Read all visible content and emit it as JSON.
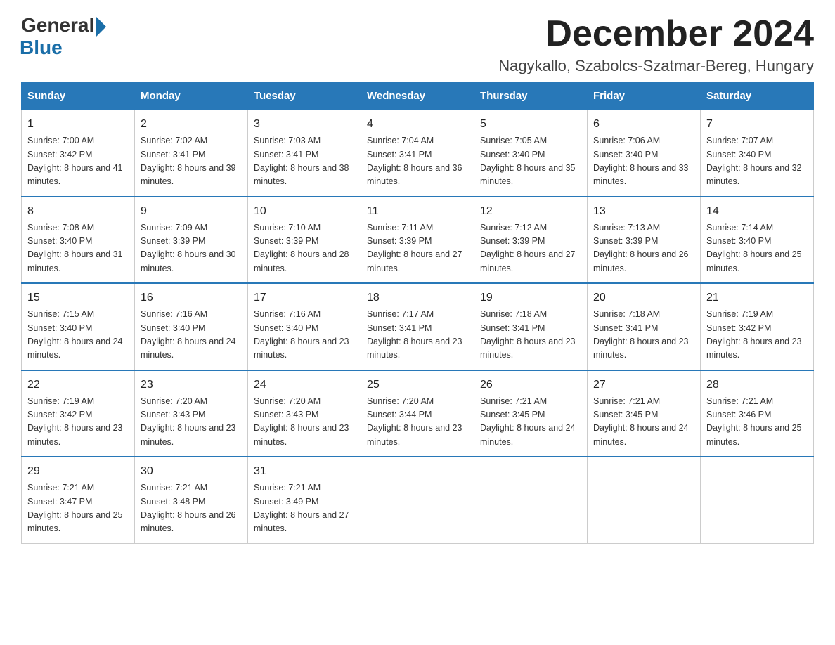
{
  "logo": {
    "general": "General",
    "blue": "Blue"
  },
  "header": {
    "month": "December 2024",
    "location": "Nagykallo, Szabolcs-Szatmar-Bereg, Hungary"
  },
  "days_of_week": [
    "Sunday",
    "Monday",
    "Tuesday",
    "Wednesday",
    "Thursday",
    "Friday",
    "Saturday"
  ],
  "weeks": [
    [
      {
        "day": "1",
        "sunrise": "7:00 AM",
        "sunset": "3:42 PM",
        "daylight": "8 hours and 41 minutes."
      },
      {
        "day": "2",
        "sunrise": "7:02 AM",
        "sunset": "3:41 PM",
        "daylight": "8 hours and 39 minutes."
      },
      {
        "day": "3",
        "sunrise": "7:03 AM",
        "sunset": "3:41 PM",
        "daylight": "8 hours and 38 minutes."
      },
      {
        "day": "4",
        "sunrise": "7:04 AM",
        "sunset": "3:41 PM",
        "daylight": "8 hours and 36 minutes."
      },
      {
        "day": "5",
        "sunrise": "7:05 AM",
        "sunset": "3:40 PM",
        "daylight": "8 hours and 35 minutes."
      },
      {
        "day": "6",
        "sunrise": "7:06 AM",
        "sunset": "3:40 PM",
        "daylight": "8 hours and 33 minutes."
      },
      {
        "day": "7",
        "sunrise": "7:07 AM",
        "sunset": "3:40 PM",
        "daylight": "8 hours and 32 minutes."
      }
    ],
    [
      {
        "day": "8",
        "sunrise": "7:08 AM",
        "sunset": "3:40 PM",
        "daylight": "8 hours and 31 minutes."
      },
      {
        "day": "9",
        "sunrise": "7:09 AM",
        "sunset": "3:39 PM",
        "daylight": "8 hours and 30 minutes."
      },
      {
        "day": "10",
        "sunrise": "7:10 AM",
        "sunset": "3:39 PM",
        "daylight": "8 hours and 28 minutes."
      },
      {
        "day": "11",
        "sunrise": "7:11 AM",
        "sunset": "3:39 PM",
        "daylight": "8 hours and 27 minutes."
      },
      {
        "day": "12",
        "sunrise": "7:12 AM",
        "sunset": "3:39 PM",
        "daylight": "8 hours and 27 minutes."
      },
      {
        "day": "13",
        "sunrise": "7:13 AM",
        "sunset": "3:39 PM",
        "daylight": "8 hours and 26 minutes."
      },
      {
        "day": "14",
        "sunrise": "7:14 AM",
        "sunset": "3:40 PM",
        "daylight": "8 hours and 25 minutes."
      }
    ],
    [
      {
        "day": "15",
        "sunrise": "7:15 AM",
        "sunset": "3:40 PM",
        "daylight": "8 hours and 24 minutes."
      },
      {
        "day": "16",
        "sunrise": "7:16 AM",
        "sunset": "3:40 PM",
        "daylight": "8 hours and 24 minutes."
      },
      {
        "day": "17",
        "sunrise": "7:16 AM",
        "sunset": "3:40 PM",
        "daylight": "8 hours and 23 minutes."
      },
      {
        "day": "18",
        "sunrise": "7:17 AM",
        "sunset": "3:41 PM",
        "daylight": "8 hours and 23 minutes."
      },
      {
        "day": "19",
        "sunrise": "7:18 AM",
        "sunset": "3:41 PM",
        "daylight": "8 hours and 23 minutes."
      },
      {
        "day": "20",
        "sunrise": "7:18 AM",
        "sunset": "3:41 PM",
        "daylight": "8 hours and 23 minutes."
      },
      {
        "day": "21",
        "sunrise": "7:19 AM",
        "sunset": "3:42 PM",
        "daylight": "8 hours and 23 minutes."
      }
    ],
    [
      {
        "day": "22",
        "sunrise": "7:19 AM",
        "sunset": "3:42 PM",
        "daylight": "8 hours and 23 minutes."
      },
      {
        "day": "23",
        "sunrise": "7:20 AM",
        "sunset": "3:43 PM",
        "daylight": "8 hours and 23 minutes."
      },
      {
        "day": "24",
        "sunrise": "7:20 AM",
        "sunset": "3:43 PM",
        "daylight": "8 hours and 23 minutes."
      },
      {
        "day": "25",
        "sunrise": "7:20 AM",
        "sunset": "3:44 PM",
        "daylight": "8 hours and 23 minutes."
      },
      {
        "day": "26",
        "sunrise": "7:21 AM",
        "sunset": "3:45 PM",
        "daylight": "8 hours and 24 minutes."
      },
      {
        "day": "27",
        "sunrise": "7:21 AM",
        "sunset": "3:45 PM",
        "daylight": "8 hours and 24 minutes."
      },
      {
        "day": "28",
        "sunrise": "7:21 AM",
        "sunset": "3:46 PM",
        "daylight": "8 hours and 25 minutes."
      }
    ],
    [
      {
        "day": "29",
        "sunrise": "7:21 AM",
        "sunset": "3:47 PM",
        "daylight": "8 hours and 25 minutes."
      },
      {
        "day": "30",
        "sunrise": "7:21 AM",
        "sunset": "3:48 PM",
        "daylight": "8 hours and 26 minutes."
      },
      {
        "day": "31",
        "sunrise": "7:21 AM",
        "sunset": "3:49 PM",
        "daylight": "8 hours and 27 minutes."
      },
      null,
      null,
      null,
      null
    ]
  ]
}
